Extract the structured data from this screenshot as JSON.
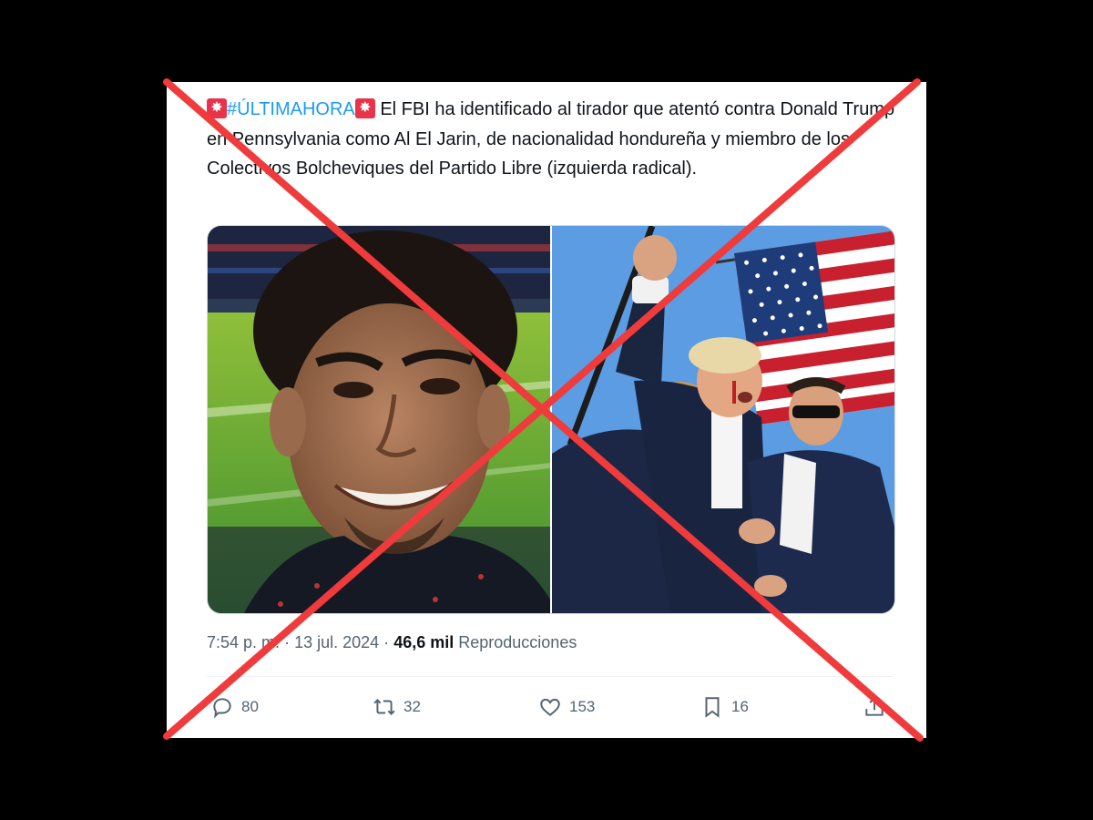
{
  "tweet": {
    "emoji_left": "🚨",
    "hashtag": "#ÚLTIMAHORA",
    "emoji_right": "🚨",
    "text": "El FBI ha identificado al tirador que atentó contra Donald Trump en Pennsylvania como Al El Jarin, de nacionalidad hondureña y miembro de los Colectivos Bolcheviques del Partido Libre (izquierda radical)."
  },
  "meta": {
    "time": "7:54 p. m.",
    "separator": "·",
    "date": "13 jul. 2024",
    "views": "46,6 mil",
    "views_label": "Reproducciones"
  },
  "actions": {
    "replies": "80",
    "retweets": "32",
    "likes": "153",
    "bookmarks": "16"
  },
  "overlay": {
    "cross_color": "#ef3b3b"
  }
}
